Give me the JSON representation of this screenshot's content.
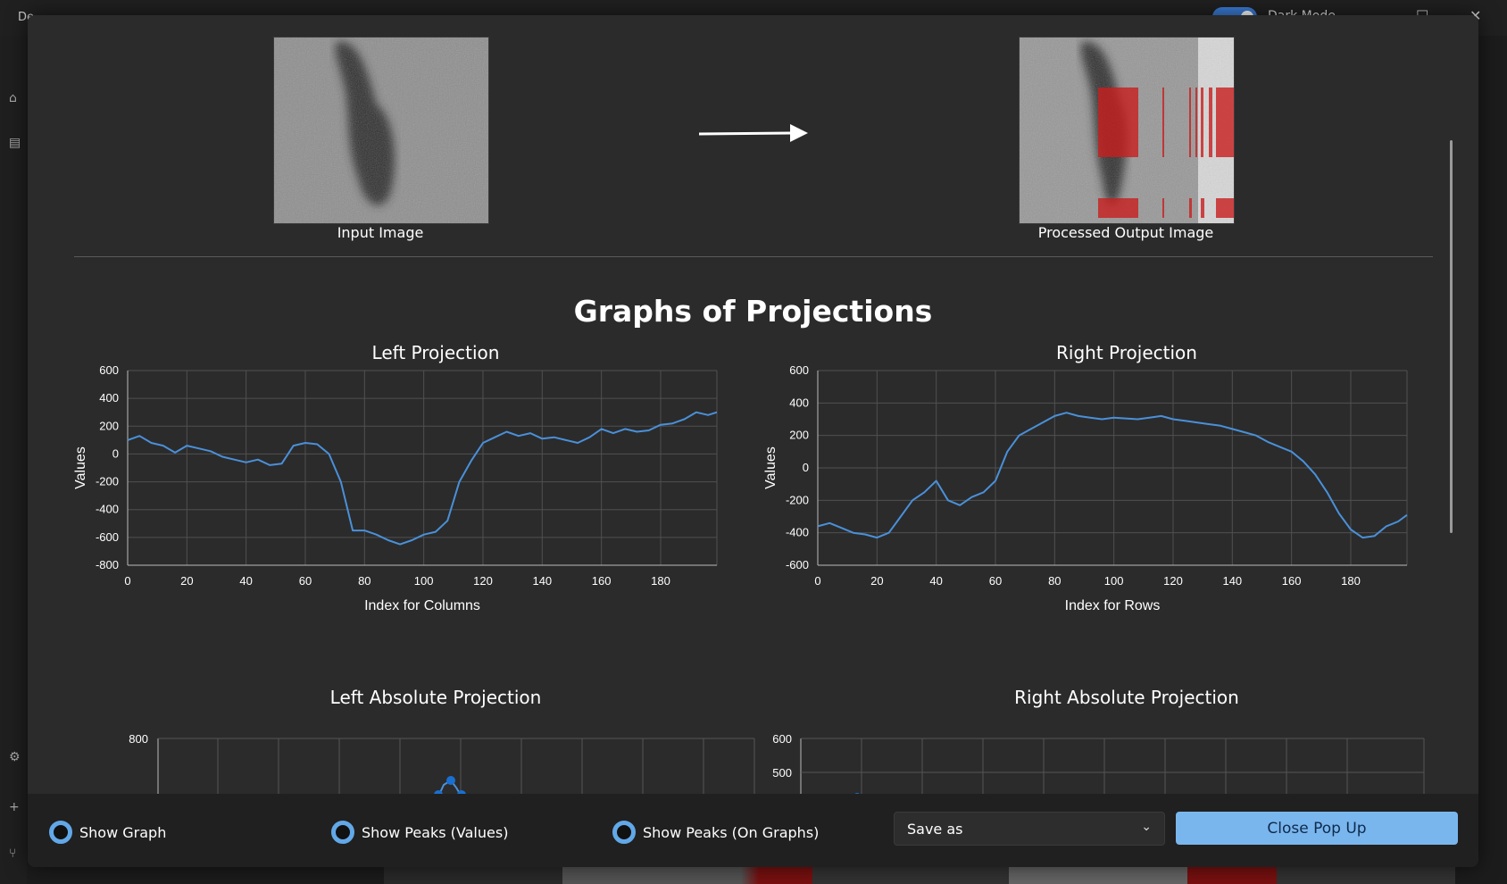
{
  "background_app": {
    "title": "De…",
    "dark_mode_label": "Dark Mode"
  },
  "images": {
    "input_caption": "Input Image",
    "output_caption": "Processed Output Image"
  },
  "section_title": "Graphs of Projections",
  "charts": {
    "left": {
      "title": "Left Projection",
      "xlabel": "Index for Columns",
      "ylabel": "Values"
    },
    "right": {
      "title": "Right Projection",
      "xlabel": "Index for Rows",
      "ylabel": "Values"
    },
    "left_abs": {
      "title": "Left Absolute Projection"
    },
    "right_abs": {
      "title": "Right Absolute Projection"
    }
  },
  "chart_data": [
    {
      "type": "line",
      "title": "Left Projection",
      "xlabel": "Index for Columns",
      "ylabel": "Values",
      "xlim": [
        0,
        199
      ],
      "ylim": [
        -800,
        600
      ],
      "xticks": [
        "0",
        "20",
        "40",
        "60",
        "80",
        "100",
        "120",
        "140",
        "160",
        "180"
      ],
      "yticks": [
        "600",
        "400",
        "200",
        "0",
        "-200",
        "-400",
        "-600",
        "-800"
      ],
      "grid": true,
      "color": "#4a90d9",
      "series": [
        {
          "x": [
            0,
            4,
            8,
            12,
            16,
            20,
            24,
            28,
            32,
            36,
            40,
            44,
            48,
            52,
            56,
            60,
            64,
            68,
            72,
            76,
            80,
            84,
            88,
            92,
            96,
            100,
            104,
            108,
            112,
            116,
            120,
            124,
            128,
            132,
            136,
            140,
            144,
            148,
            152,
            156,
            160,
            164,
            168,
            172,
            176,
            180,
            184,
            188,
            192,
            196,
            199
          ],
          "values": [
            100,
            130,
            80,
            60,
            10,
            60,
            40,
            20,
            -20,
            -40,
            -60,
            -40,
            -80,
            -70,
            60,
            80,
            70,
            0,
            -200,
            -550,
            -550,
            -580,
            -620,
            -650,
            -620,
            -580,
            -560,
            -480,
            -200,
            -50,
            80,
            120,
            160,
            130,
            150,
            110,
            120,
            100,
            80,
            120,
            180,
            150,
            180,
            160,
            170,
            210,
            220,
            250,
            300,
            280,
            300
          ]
        }
      ]
    },
    {
      "type": "line",
      "title": "Right Projection",
      "xlabel": "Index for Rows",
      "ylabel": "Values",
      "xlim": [
        0,
        199
      ],
      "ylim": [
        -600,
        600
      ],
      "xticks": [
        "0",
        "20",
        "40",
        "60",
        "80",
        "100",
        "120",
        "140",
        "160",
        "180"
      ],
      "yticks": [
        "600",
        "400",
        "200",
        "0",
        "-200",
        "-400",
        "-600"
      ],
      "grid": true,
      "color": "#4a90d9",
      "series": [
        {
          "x": [
            0,
            4,
            8,
            12,
            16,
            20,
            24,
            28,
            32,
            36,
            40,
            44,
            48,
            52,
            56,
            60,
            64,
            68,
            72,
            76,
            80,
            84,
            88,
            92,
            96,
            100,
            104,
            108,
            112,
            116,
            120,
            124,
            128,
            132,
            136,
            140,
            144,
            148,
            152,
            156,
            160,
            164,
            168,
            172,
            176,
            180,
            184,
            188,
            192,
            196,
            199
          ],
          "values": [
            -360,
            -340,
            -370,
            -400,
            -410,
            -430,
            -400,
            -300,
            -200,
            -150,
            -80,
            -200,
            -230,
            -180,
            -150,
            -80,
            100,
            200,
            240,
            280,
            320,
            340,
            320,
            310,
            300,
            310,
            305,
            300,
            310,
            320,
            300,
            290,
            280,
            270,
            260,
            240,
            220,
            200,
            160,
            130,
            100,
            40,
            -40,
            -150,
            -280,
            -380,
            -430,
            -420,
            -360,
            -330,
            -290
          ]
        }
      ]
    }
  ],
  "partial_charts": {
    "left_abs": {
      "ytick_top": "800"
    },
    "right_abs": {
      "ytick_top": "600",
      "ytick_second": "500"
    }
  },
  "footer": {
    "show_graph": "Show Graph",
    "show_peaks_values": "Show Peaks (Values)",
    "show_peaks_graphs": "Show Peaks (On Graphs)",
    "save_as": "Save as",
    "close_button": "Close Pop Up"
  },
  "colors": {
    "accent": "#62a8e8",
    "button": "#7ab6ee",
    "line": "#4a90d9",
    "highlight": "#c81e1e"
  }
}
